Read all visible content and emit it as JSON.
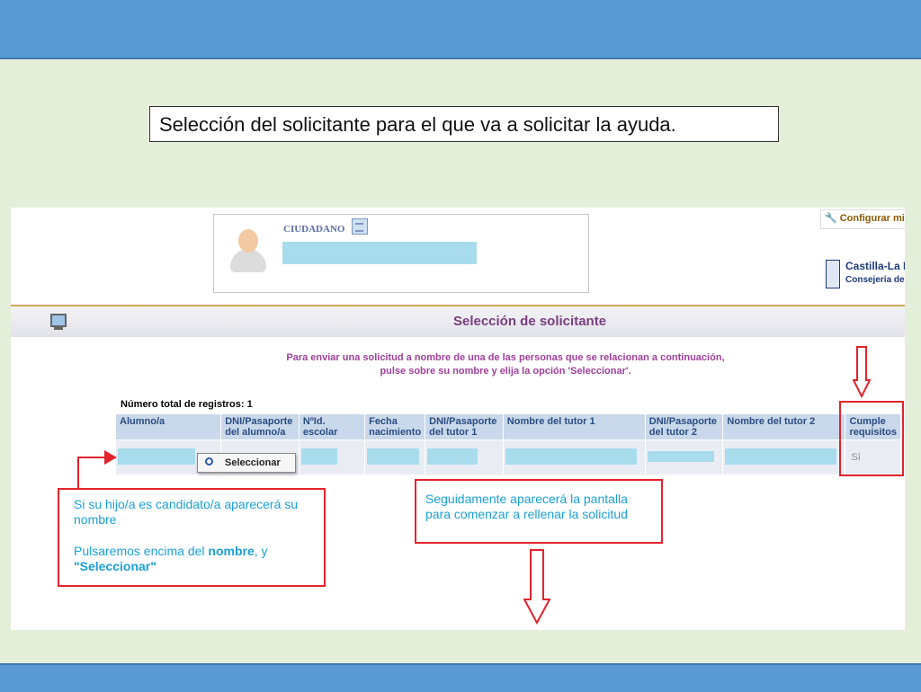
{
  "slide": {
    "title": "Selección del solicitante para el que va a solicitar la ayuda."
  },
  "header": {
    "ciudadano_label": "CIUDADANO",
    "config_label": "Configurar mi",
    "logo_line1": "Castilla-La M",
    "logo_line2": "Consejería de E"
  },
  "section": {
    "title": "Selección de solicitante",
    "instruction_line1": "Para enviar una solicitud a nombre de una de las personas que se relacionan a continuación,",
    "instruction_line2": "pulse sobre su nombre y elija la opción 'Seleccionar'.",
    "record_count": "Número total de registros: 1"
  },
  "table": {
    "headers": [
      "Alumno/a",
      "DNI/Pasaporte del alumno/a",
      "NºId. escolar",
      "Fecha nacimiento",
      "DNI/Pasaporte del tutor 1",
      "Nombre del tutor 1",
      "DNI/Pasaporte del tutor 2",
      "Nombre del tutor 2",
      "Cumple requisitos"
    ],
    "row": {
      "cumple": "Sí"
    }
  },
  "popup": {
    "label": "Seleccionar"
  },
  "callouts": {
    "left_line1": "Si su hijo/a es candidato/a aparecerá su nombre",
    "left_line2_pre": "Pulsaremos encima del ",
    "left_line2_bold": "nombre",
    "left_line2_post": ", y",
    "left_line3_bold": "\"Seleccionar\"",
    "mid_text": "Seguidamente aparecerá la pantalla para comenzar a rellenar la solicitud"
  },
  "colors": {
    "slide_bar": "#5b9bd5",
    "slide_bg": "#e4efd9",
    "callout_border": "#e3232c",
    "callout_text": "#1aa0d8",
    "section_title": "#7a3e7e",
    "redaction": "#a8dced"
  }
}
